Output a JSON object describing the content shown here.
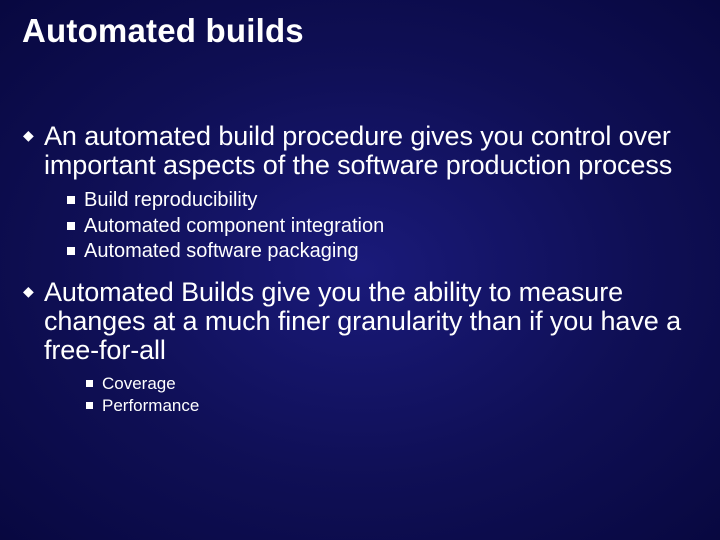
{
  "title": "Automated builds",
  "bullets": [
    {
      "text": "An automated build procedure gives you control over important aspects of the software production process",
      "sub": [
        {
          "text": "Build reproducibility"
        },
        {
          "text": "Automated component integration"
        },
        {
          "text": "Automated software packaging"
        }
      ]
    },
    {
      "text": "Automated Builds give you the ability to measure changes at a much finer granularity than if you have a free-for-all",
      "sub2": [
        {
          "text": "Coverage"
        },
        {
          "text": "Performance"
        }
      ]
    }
  ]
}
